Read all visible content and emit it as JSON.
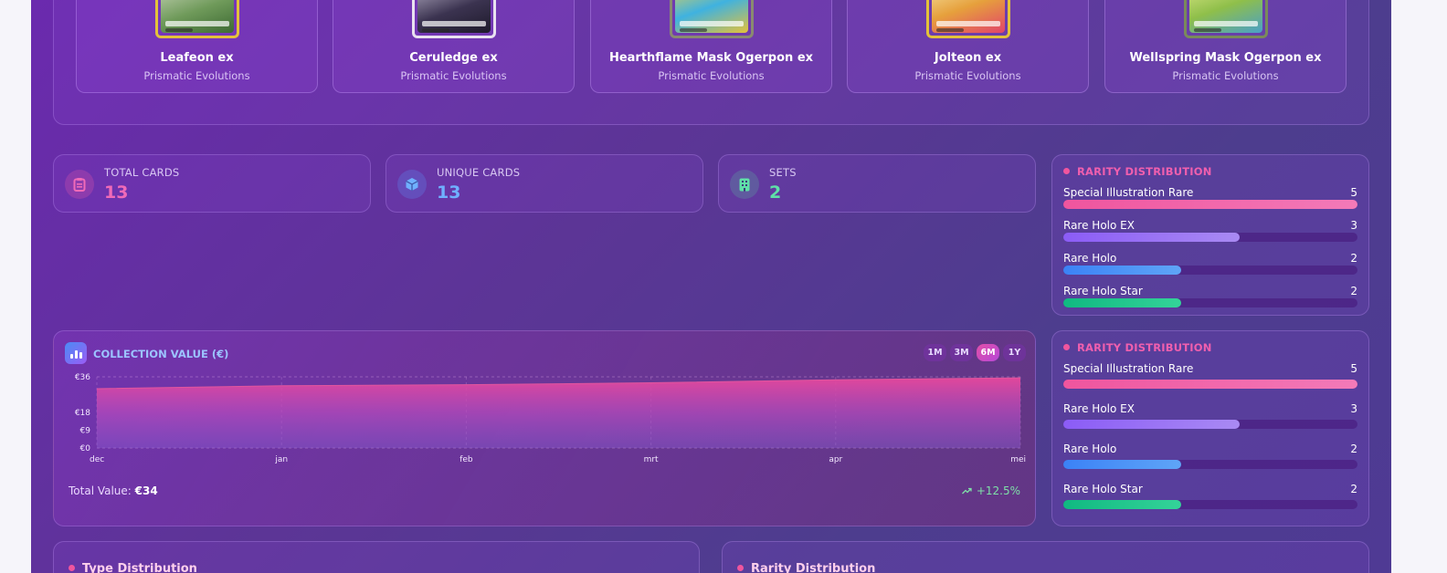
{
  "cards": [
    {
      "name": "Leafeon ex",
      "set": "Prismatic Evolutions",
      "art_color": "#6f9a5a"
    },
    {
      "name": "Ceruledge ex",
      "set": "Prismatic Evolutions",
      "art_color": "#3b3350"
    },
    {
      "name": "Hearthflame Mask Ogerpon ex",
      "set": "Prismatic Evolutions",
      "art_color": "#3fb2e0"
    },
    {
      "name": "Jolteon ex",
      "set": "Prismatic Evolutions",
      "art_color": "#e6a03c"
    },
    {
      "name": "Wellspring Mask Ogerpon ex",
      "set": "Prismatic Evolutions",
      "art_color": "#8fbf4a"
    }
  ],
  "stats": [
    {
      "label": "TOTAL CARDS",
      "value": "13",
      "icon": "clipboard-icon",
      "color": "#f06ab8"
    },
    {
      "label": "UNIQUE CARDS",
      "value": "13",
      "icon": "cube-icon",
      "color": "#6fb0ff"
    },
    {
      "label": "SETS",
      "value": "2",
      "icon": "building-icon",
      "color": "#5fe0a8"
    }
  ],
  "rarity": {
    "title": "RARITY DISTRIBUTION",
    "max": 5,
    "items": [
      {
        "name": "Special Illustration Rare",
        "count": "5",
        "value": 5,
        "color_from": "#f0559e",
        "color_to": "#f37ab8"
      },
      {
        "name": "Rare Holo EX",
        "count": "3",
        "value": 3,
        "color_from": "#8b5cf6",
        "color_to": "#a98af3"
      },
      {
        "name": "Rare Holo",
        "count": "2",
        "value": 2,
        "color_from": "#3b82f6",
        "color_to": "#5fa5f7"
      },
      {
        "name": "Rare Holo Star",
        "count": "2",
        "value": 2,
        "color_from": "#10b981",
        "color_to": "#34d399"
      }
    ]
  },
  "collection_value": {
    "title": "COLLECTION VALUE (€)",
    "ranges": [
      "1M",
      "3M",
      "6M",
      "1Y"
    ],
    "active_range": "6M",
    "total_label": "Total Value:",
    "total_value": "€34",
    "growth": "+12.5%",
    "growth_icon": "trending-up-icon"
  },
  "chart_data": {
    "type": "area",
    "x": [
      "dec",
      "jan",
      "feb",
      "mrt",
      "apr",
      "mei"
    ],
    "values": [
      30,
      31.5,
      32,
      33,
      34.5,
      35.5
    ],
    "y_ticks": [
      "€0",
      "€9",
      "€18",
      "€36"
    ],
    "ylim": [
      0,
      36
    ],
    "grid": true
  },
  "bottom": {
    "left_title": "Type Distribution",
    "right_title": "Rarity Distribution"
  }
}
